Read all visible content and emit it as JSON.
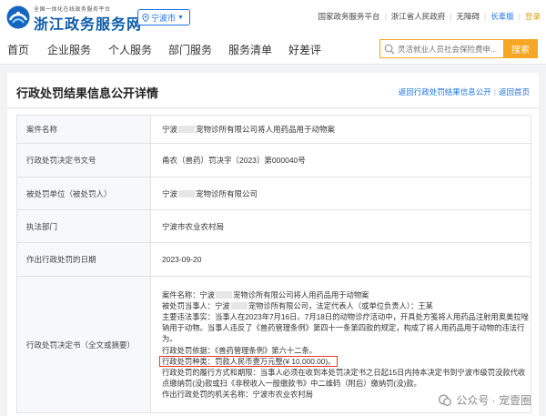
{
  "header": {
    "logo_subtitle": "全国一体化在线政务服务平台",
    "logo_title": "浙江政务服务网",
    "region": "宁波市",
    "links": [
      {
        "label": "国家政务服务平台"
      },
      {
        "label": "浙江省人民政府"
      },
      {
        "label": "无障碍"
      },
      {
        "label": "长辈版"
      },
      {
        "label": "登录"
      }
    ]
  },
  "nav": {
    "items": [
      "首页",
      "企业服务",
      "个人服务",
      "部门服务",
      "服务清单",
      "好差评"
    ],
    "search_placeholder": "灵活就业人员社会保险费申...",
    "search_button": "搜索"
  },
  "page": {
    "title": "行政处罚结果信息公开详情",
    "back_list": "返回行政处罚结果信息公开",
    "back_home": "返回首页"
  },
  "record": {
    "case_name": {
      "label": "案件名称",
      "pre": "宁波",
      "post": "宠物诊所有限公司将人用药品用于动物案"
    },
    "doc_no": {
      "label": "行政处罚决定书文号",
      "value": "甬农（兽药）罚决字〔2023〕第000040号"
    },
    "party": {
      "label": "被处罚单位（被处罚人）",
      "pre": "宁波",
      "post": "宠物诊所有限公司"
    },
    "dept": {
      "label": "执法部门",
      "value": "宁波市农业农村局"
    },
    "date": {
      "label": "作出行政处罚的日期",
      "value": "2023-09-20"
    },
    "decision": {
      "label": "行政处罚决定书（全文或摘要）",
      "line1_pre": "案件名称：宁波",
      "line1_post": "宠物诊所有限公司将人用药品用于动物案",
      "line2_pre": "被处罚当事人：宁波",
      "line2_post": "宠物诊所有限公司，法定代表人（或单位负责人）：王某",
      "line3": "主要违法事实：当事人在2023年7月16日、7月18日的动物诊疗活动中，开具处方笺将人用药品注射用奥美拉唑钠用于动物。当事人违反了《兽药管理条例》第四十一条第四款的规定，构成了将人用药品用于动物的违法行为。",
      "line4": "行政处罚依据：《兽药管理条例》第六十二条。",
      "line5": "行政处罚种类：罚款人民币壹万元整(¥ 10,000.00)。",
      "line6": "行政处罚的履行方式和期限：当事人必须在收到本处罚决定书之日起15日内持本决定书到宁波市级罚没款代收点缴纳罚(没)款或扫《非税收入一般缴款书》中二维码（附后）缴纳罚(没)款。",
      "line7": "作出行政处罚的机关名称：宁波市农业农村局"
    }
  },
  "watermark": {
    "text": "公众号 · 宠壹圈"
  },
  "colors": {
    "brand_blue": "#0e5cab",
    "accent_orange": "#f5a623",
    "link_blue": "#1a73e8",
    "highlight_red": "#e53935"
  }
}
